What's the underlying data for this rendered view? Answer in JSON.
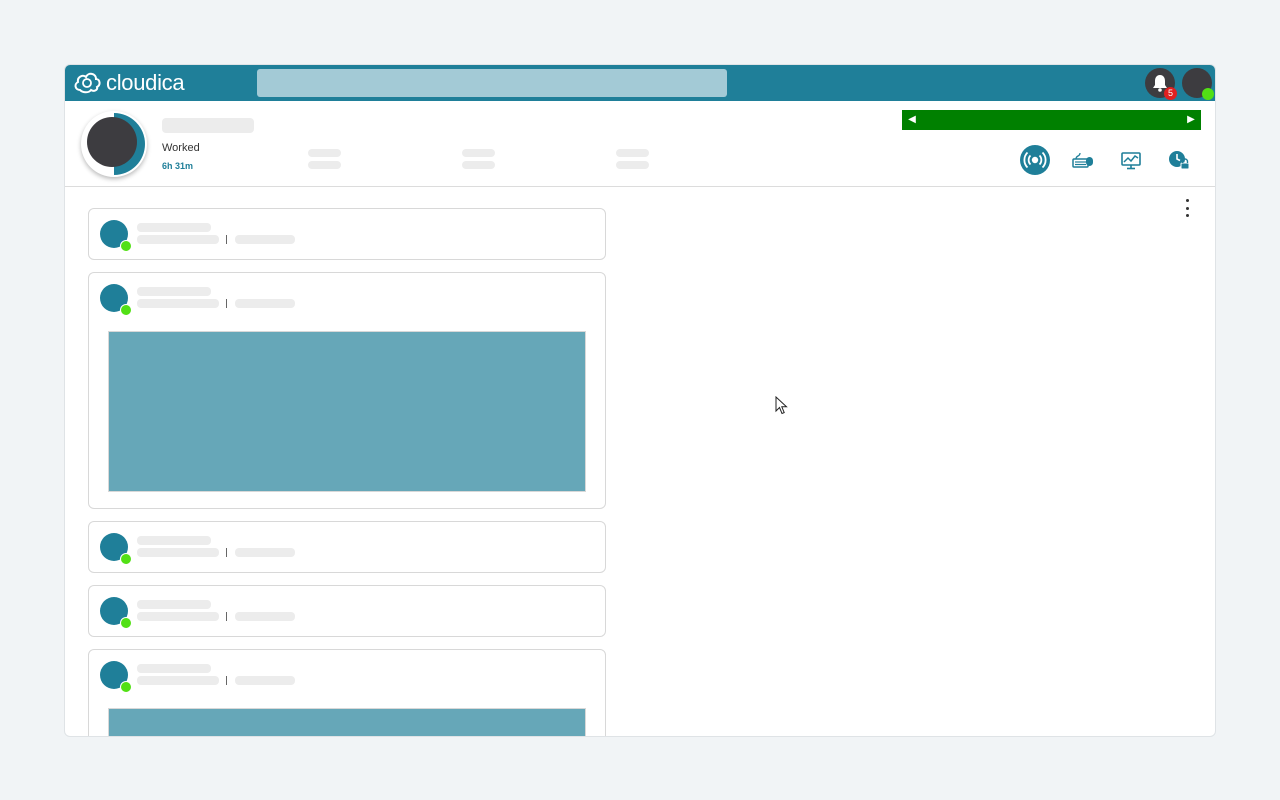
{
  "brand": {
    "name": "cloudica"
  },
  "topbar": {
    "search_placeholder": "",
    "notifications": {
      "count": "5"
    }
  },
  "header": {
    "worked_label": "Worked",
    "worked_time": "6h 31m"
  },
  "colors": {
    "brand": "#1f7f99",
    "status_online": "#52e015",
    "banner": "#008000",
    "badge": "#e02020",
    "media": "#66a7b8"
  },
  "tool_icons": [
    "broadcast-icon",
    "keyboard-mouse-icon",
    "activity-monitor-icon",
    "clock-lock-icon"
  ],
  "feed": {
    "post_count": 5
  }
}
